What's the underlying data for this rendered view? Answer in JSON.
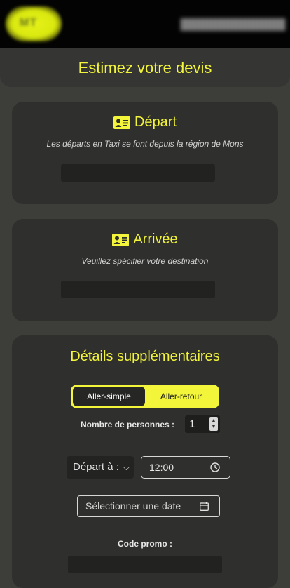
{
  "header": {
    "logo_text": "MT",
    "nav_link": ""
  },
  "page": {
    "title": "Estimez votre devis"
  },
  "departure": {
    "heading": "Départ",
    "subtitle": "Les départs en Taxi se font depuis la région de Mons",
    "input_value": ""
  },
  "arrival": {
    "heading": "Arrivée",
    "subtitle": "Veuillez spécifier votre destination",
    "input_value": ""
  },
  "details": {
    "heading": "Détails supplémentaires",
    "trip_options": [
      "Aller-simple",
      "Aller-retour"
    ],
    "trip_selected": "Aller-simple",
    "persons_label": "Nombre de personnes :",
    "persons_value": "1",
    "departure_select": "Départ à :",
    "time_value": "12:00",
    "date_placeholder": "Sélectionner une date",
    "promo_label": "Code promo :",
    "promo_value": ""
  },
  "colors": {
    "accent": "#f2f53a",
    "background": "#3d3d3a",
    "card": "#2f2f2d"
  }
}
